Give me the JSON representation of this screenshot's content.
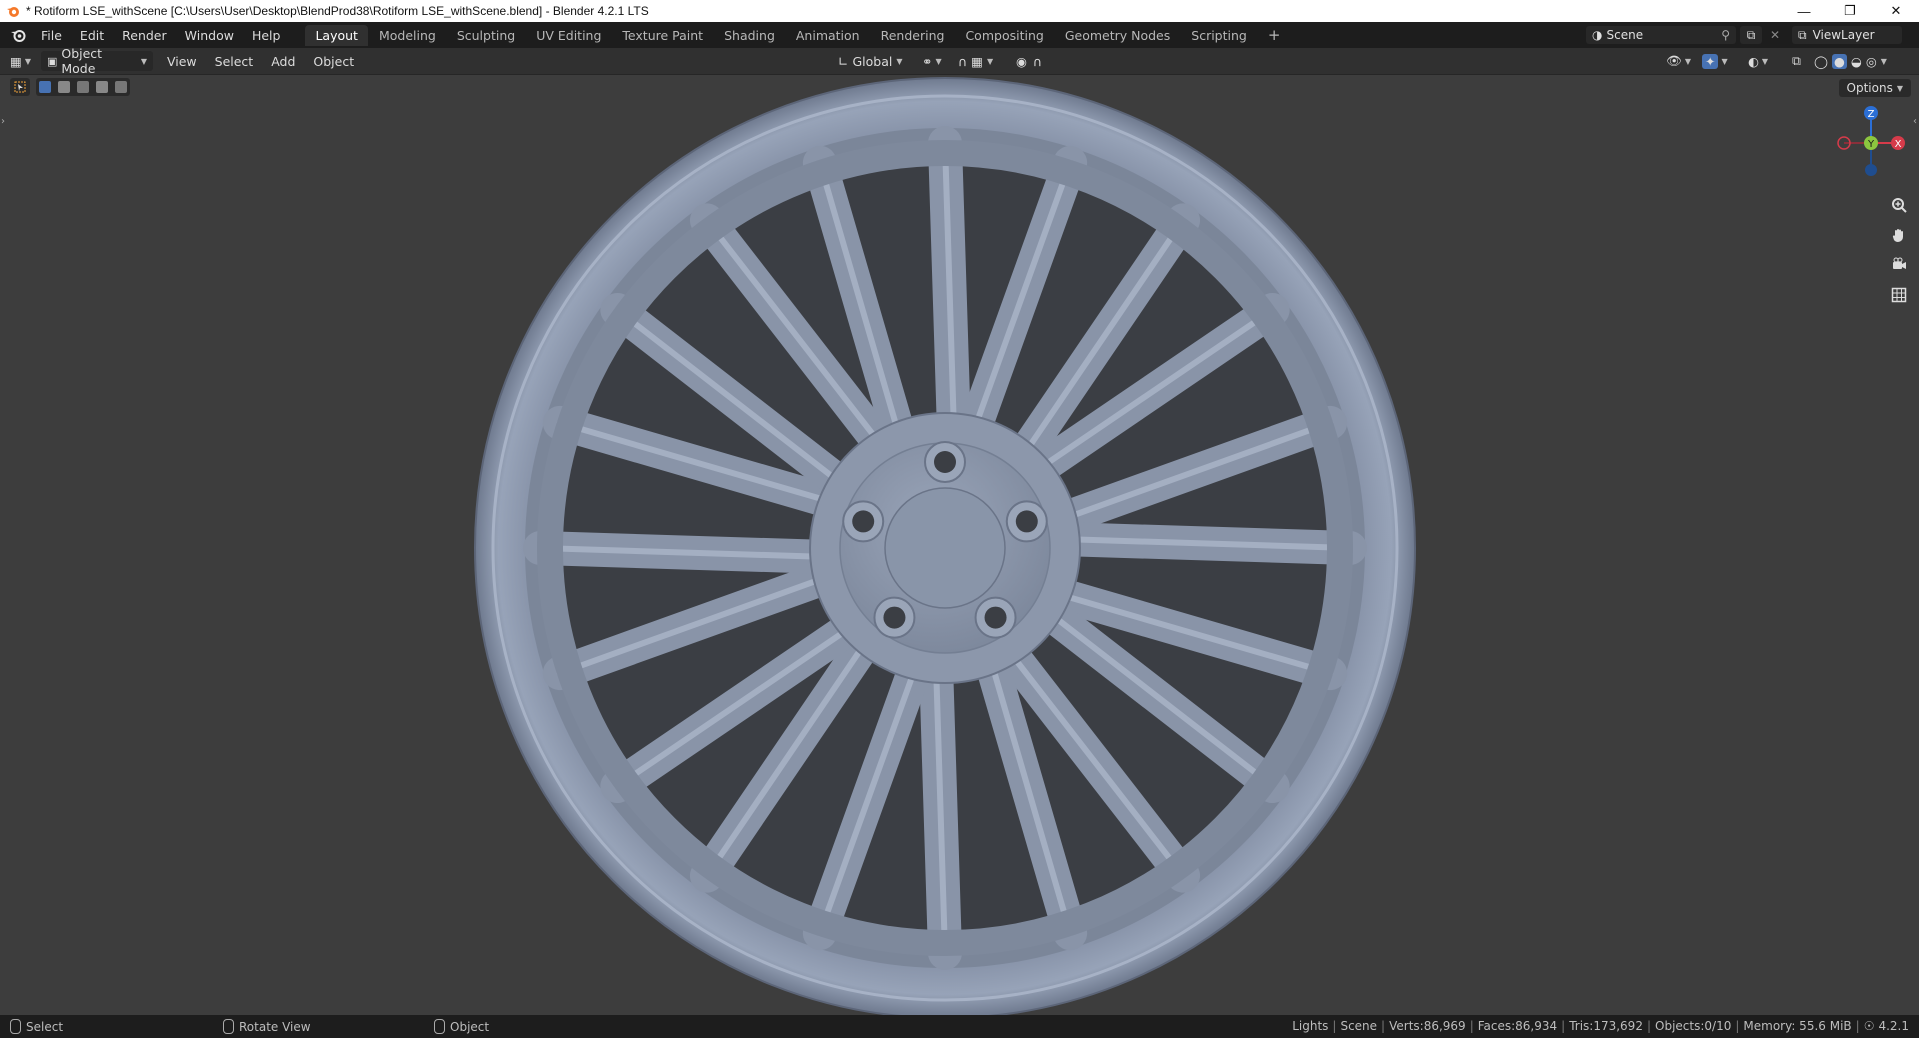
{
  "window": {
    "title": "* Rotiform LSE_withScene [C:\\Users\\User\\Desktop\\BlendProd38\\Rotiform LSE_withScene.blend] - Blender 4.2.1 LTS"
  },
  "menu": [
    "File",
    "Edit",
    "Render",
    "Window",
    "Help"
  ],
  "workspaces": [
    {
      "label": "Layout",
      "active": true
    },
    {
      "label": "Modeling"
    },
    {
      "label": "Sculpting"
    },
    {
      "label": "UV Editing"
    },
    {
      "label": "Texture Paint"
    },
    {
      "label": "Shading"
    },
    {
      "label": "Animation"
    },
    {
      "label": "Rendering"
    },
    {
      "label": "Compositing"
    },
    {
      "label": "Geometry Nodes"
    },
    {
      "label": "Scripting"
    }
  ],
  "scene": {
    "name": "Scene",
    "view_layer": "ViewLayer"
  },
  "header": {
    "mode": "Object Mode",
    "menus": [
      "View",
      "Select",
      "Add",
      "Object"
    ],
    "transform_orientation": "Global"
  },
  "viewport": {
    "options_label": "Options",
    "gizmo": {
      "z": "Z",
      "y": "Y",
      "x": "X"
    },
    "bg_color": "#3d3d3d",
    "model_color": "#8e99ad"
  },
  "status": {
    "left": [
      {
        "label": "Select"
      },
      {
        "label": "Rotate View"
      },
      {
        "label": "Object"
      }
    ],
    "stats": [
      "Lights",
      "Scene",
      "Verts:86,969",
      "Faces:86,934",
      "Tris:173,692",
      "Objects:0/10",
      "Memory: 55.6 MiB"
    ],
    "version": "4.2.1"
  }
}
